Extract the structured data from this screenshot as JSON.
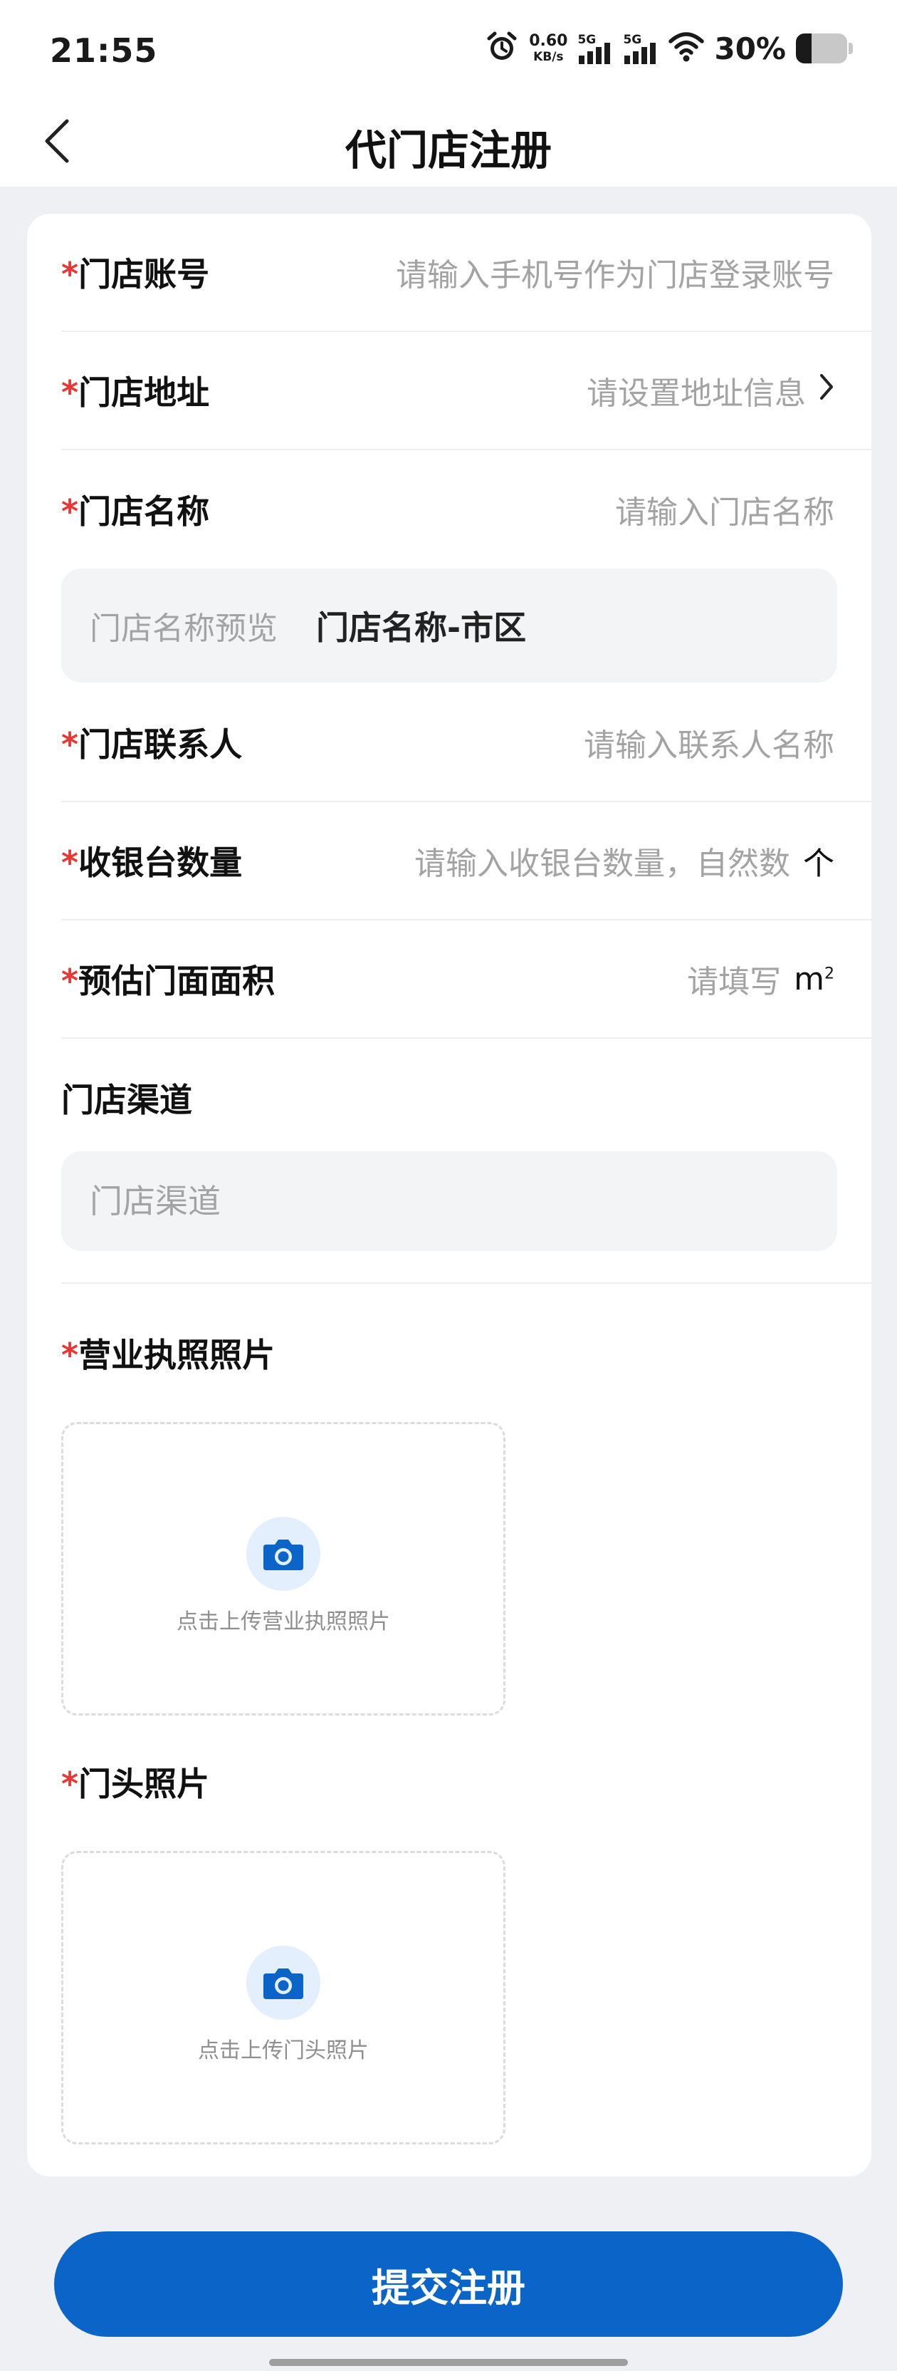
{
  "status_bar": {
    "time": "21:55",
    "net_speed_value": "0.60",
    "net_speed_unit": "KB/s",
    "signal1_label": "5G",
    "signal2_label": "5G",
    "battery_text": "30%"
  },
  "nav": {
    "title": "代门店注册"
  },
  "form": {
    "required_mark": "*",
    "account": {
      "label": "门店账号",
      "placeholder": "请输入手机号作为门店登录账号"
    },
    "address": {
      "label": "门店地址",
      "placeholder": "请设置地址信息"
    },
    "name": {
      "label": "门店名称",
      "placeholder": "请输入门店名称"
    },
    "preview": {
      "label": "门店名称预览",
      "value": "门店名称-市区"
    },
    "contact": {
      "label": "门店联系人",
      "placeholder": "请输入联系人名称"
    },
    "cashier": {
      "label": "收银台数量",
      "placeholder": "请输入收银台数量，自然数",
      "unit": "个"
    },
    "area": {
      "label": "预估门面面积",
      "placeholder": "请填写",
      "unit": "m",
      "unit_sup": "2"
    },
    "channel": {
      "label": "门店渠道",
      "placeholder": "门店渠道"
    },
    "license": {
      "label": "营业执照照片",
      "upload_text": "点击上传营业执照照片"
    },
    "storefront": {
      "label": "门头照片",
      "upload_text": "点击上传门头照片"
    }
  },
  "submit_label": "提交注册",
  "icons": {
    "back": "chevron-left-icon",
    "chevron": "chevron-right-icon",
    "camera": "camera-icon",
    "alarm": "alarm-icon",
    "wifi": "wifi-icon",
    "battery": "battery-icon"
  },
  "colors": {
    "accent": "#0b64c8",
    "required": "#e53935",
    "placeholder": "#a3a3a3",
    "background": "#eef0f3"
  }
}
